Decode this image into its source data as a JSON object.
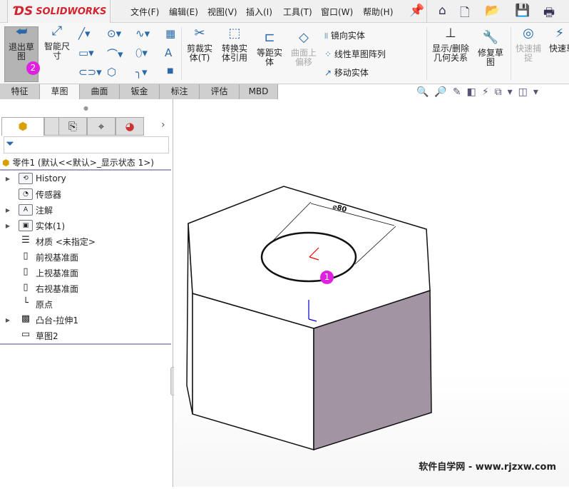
{
  "app": {
    "logo": "SOLIDWORKS",
    "logo_mark": "DS"
  },
  "menu": [
    "文件(F)",
    "编辑(E)",
    "视图(V)",
    "插入(I)",
    "工具(T)",
    "窗口(W)",
    "帮助(H)"
  ],
  "ribbon": {
    "exit_sketch": "退出草图",
    "smart_dim": "智能尺寸",
    "trim": "剪裁实体(T)",
    "convert": "转换实体引用",
    "offset": "等距实体",
    "surface_offset": "曲面上偏移",
    "mirror": "镜向实体",
    "linear_pattern": "线性草图阵列",
    "move": "移动实体",
    "show_relations": "显示/删除几何关系",
    "repair": "修复草图",
    "quick_snap": "快速捕捉",
    "rapid": "快速草图"
  },
  "tabs": [
    "特征",
    "草图",
    "曲面",
    "钣金",
    "标注",
    "评估",
    "MBD"
  ],
  "active_tab": "草图",
  "tree": {
    "root": "零件1 (默认<<默认>_显示状态 1>)",
    "items": [
      {
        "label": "History",
        "expand": true,
        "icon": "history-icon"
      },
      {
        "label": "传感器",
        "expand": false,
        "icon": "sensor-icon"
      },
      {
        "label": "注解",
        "expand": true,
        "icon": "annotation-icon"
      },
      {
        "label": "实体(1)",
        "expand": true,
        "icon": "solid-body-icon"
      },
      {
        "label": "材质 <未指定>",
        "expand": false,
        "icon": "material-icon"
      },
      {
        "label": "前视基准面",
        "expand": false,
        "icon": "plane-icon"
      },
      {
        "label": "上视基准面",
        "expand": false,
        "icon": "plane-icon"
      },
      {
        "label": "右视基准面",
        "expand": false,
        "icon": "plane-icon"
      },
      {
        "label": "原点",
        "expand": false,
        "icon": "origin-icon"
      },
      {
        "label": "凸台-拉伸1",
        "expand": true,
        "icon": "extrude-icon"
      },
      {
        "label": "草图2",
        "expand": false,
        "icon": "sketch-icon"
      }
    ]
  },
  "viewport": {
    "dimension": "⌀80",
    "badge1": "1",
    "badge2": "2"
  },
  "watermark": "软件自学网 - www.rjzxw.com",
  "colors": {
    "side_face": "#a394a4",
    "accent": "#e020e0"
  }
}
